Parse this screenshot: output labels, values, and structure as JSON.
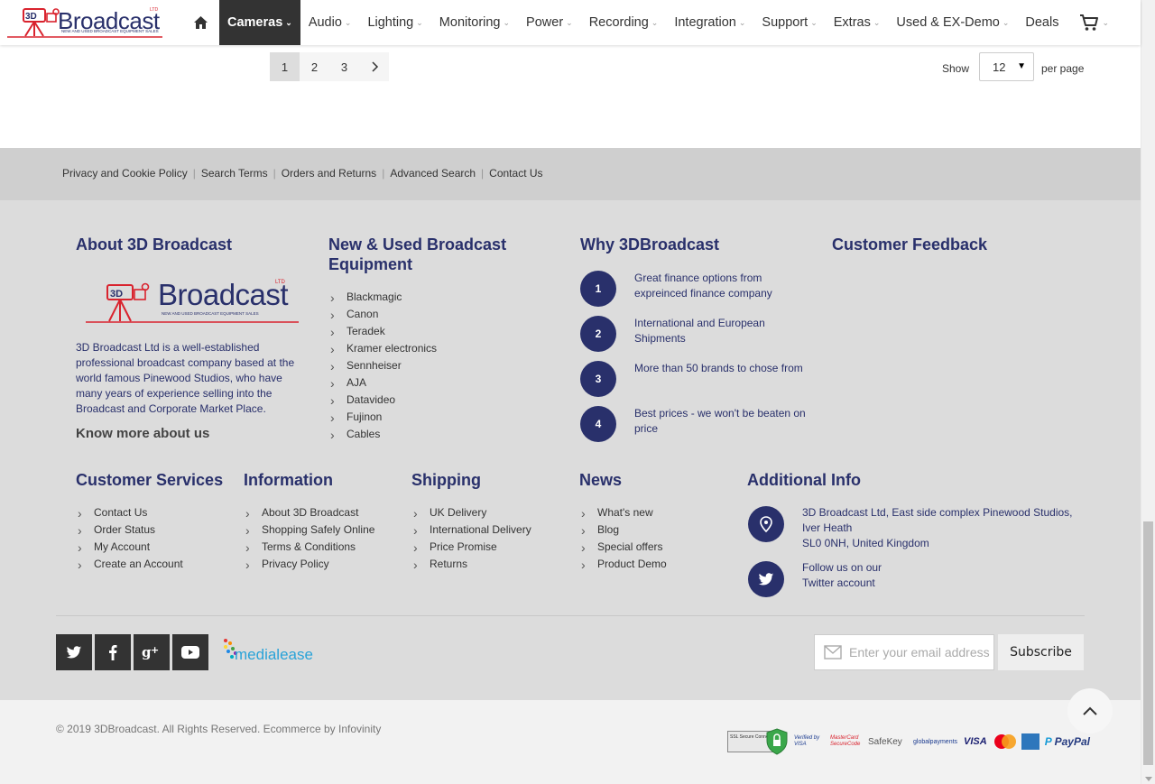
{
  "header": {
    "logo_text": "Broadcast",
    "logo_badge": "3D",
    "logo_ltd": "LTD",
    "logo_tagline": "NEW AND USED BROADCAST EQUIPMENT SALES",
    "nav": [
      {
        "label": "Cameras",
        "active": true
      },
      {
        "label": "Audio"
      },
      {
        "label": "Lighting"
      },
      {
        "label": "Monitoring"
      },
      {
        "label": "Power"
      },
      {
        "label": "Recording"
      },
      {
        "label": "Integration"
      },
      {
        "label": "Support"
      },
      {
        "label": "Extras"
      },
      {
        "label": "Used & EX-Demo"
      },
      {
        "label": "Deals"
      }
    ],
    "home_icon": "home-icon",
    "cart_icon": "cart-icon"
  },
  "pagination": {
    "pages": [
      "1",
      "2",
      "3"
    ],
    "current": "1",
    "next_icon": "chevron-right-icon",
    "show_label": "Show",
    "per_page_value": "12",
    "per_page_label": "per page"
  },
  "footer_links": [
    "Privacy and Cookie Policy",
    "Search Terms",
    "Orders and Returns",
    "Advanced Search",
    "Contact Us"
  ],
  "about": {
    "title": "About 3D Broadcast",
    "text": "3D Broadcast Ltd is a well-established professional broadcast company based at the world famous Pinewood Studios, who have many years of experience selling into the Broadcast and Corporate Market Place.",
    "more_link": "Know more about us"
  },
  "equipment": {
    "title": "New & Used Broadcast Equipment",
    "items": [
      "Blackmagic",
      "Canon",
      "Teradek",
      "Kramer electronics",
      "Sennheiser",
      "AJA",
      "Datavideo",
      "Fujinon",
      "Cables"
    ]
  },
  "why": {
    "title": "Why 3DBroadcast",
    "items": [
      {
        "num": "1",
        "text": "Great finance options from expreinced finance company"
      },
      {
        "num": "2",
        "text": "International and European Shipments"
      },
      {
        "num": "3",
        "text": "More than 50 brands to chose from"
      },
      {
        "num": "4",
        "text": "Best prices - we won't be beaten on price"
      }
    ]
  },
  "feedback": {
    "title": "Customer Feedback"
  },
  "customer_services": {
    "title": "Customer Services",
    "items": [
      "Contact Us",
      "Order Status",
      "My Account",
      "Create an Account"
    ]
  },
  "information": {
    "title": "Information",
    "items": [
      "About 3D Broadcast",
      "Shopping Safely Online",
      "Terms & Conditions",
      "Privacy Policy"
    ]
  },
  "shipping": {
    "title": "Shipping",
    "items": [
      "UK Delivery",
      "International Delivery",
      "Price Promise",
      "Returns"
    ]
  },
  "news": {
    "title": "News",
    "items": [
      "What's new",
      "Blog",
      "Special offers",
      "Product Demo"
    ]
  },
  "additional": {
    "title": "Additional Info",
    "address_line1": "3D Broadcast Ltd, East side complex Pinewood Studios,",
    "address_line2": "Iver Heath",
    "address_line3": "SL0 0NH, United Kingdom",
    "twitter_line1": "Follow us on our",
    "twitter_line2": "Twitter account",
    "address_icon": "map-pin-icon",
    "twitter_icon": "twitter-icon"
  },
  "social": [
    {
      "icon": "twitter-icon"
    },
    {
      "icon": "facebook-icon"
    },
    {
      "icon": "google-plus-icon"
    },
    {
      "icon": "youtube-icon"
    }
  ],
  "medialease": {
    "label": "medialease"
  },
  "newsletter": {
    "placeholder": "Enter your email address",
    "button": "Subscribe"
  },
  "bottom": {
    "copyright": "© 2019 3DBroadcast. All Rights Reserved. Ecommerce by Infovinity",
    "payment_labels": {
      "ssl": "SSL Secure Connection",
      "verified": "Verified by VISA",
      "mastercard_secure": "MasterCard SecureCode",
      "safekey": "SafeKey",
      "global": "globalpayments",
      "visa": "VISA",
      "paypal": "PayPal"
    }
  },
  "colors": {
    "brand_navy": "#29306b",
    "brand_red": "#d9232e",
    "nav_active": "#333333"
  }
}
